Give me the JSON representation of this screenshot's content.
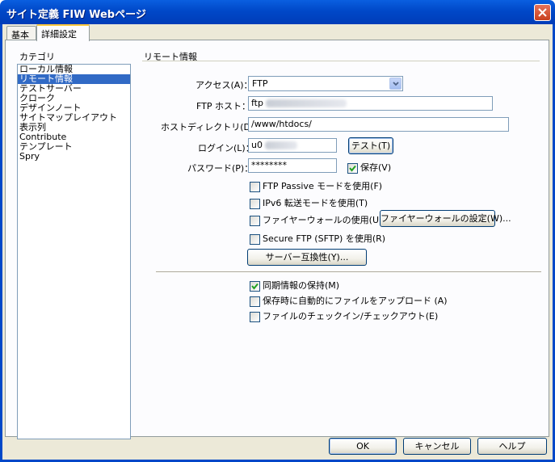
{
  "window": {
    "title": "サイト定義 FIW  Webページ"
  },
  "tabs": [
    {
      "label": "基本"
    },
    {
      "label": "詳細設定"
    }
  ],
  "category": {
    "label": "カテゴリ",
    "items": [
      "ローカル情報",
      "リモート情報",
      "テストサーバー",
      "クローク",
      "デザインノート",
      "サイトマップレイアウト",
      "表示列",
      "Contribute",
      "テンプレート",
      "Spry"
    ],
    "selected_index": 1
  },
  "remote": {
    "section_title": "リモート情報",
    "access_label": "アクセス(A)：",
    "access_value": "FTP",
    "host_label": "FTP ホスト：",
    "host_value": "ftp",
    "dir_label": "ホストディレクトリ(D)：",
    "dir_value": "/www/htdocs/",
    "login_label": "ログイン(L)：",
    "login_value": "u0",
    "test_button": "テスト(T)",
    "password_label": "パスワード(P)：",
    "password_value": "********",
    "save_label": "保存(V)",
    "save_checked": true,
    "passive_label": "FTP Passive モードを使用(F)",
    "passive_checked": false,
    "ipv6_label": "IPv6 転送モードを使用(T)",
    "ipv6_checked": false,
    "firewall_label": "ファイヤーウォールの使用(U)",
    "firewall_checked": false,
    "firewall_button": "ファイヤーウォールの設定(W)...",
    "sftp_label": "Secure FTP (SFTP) を使用(R)",
    "sftp_checked": false,
    "compat_button": "サーバー互換性(Y)...",
    "sync_label": "同期情報の保持(M)",
    "sync_checked": true,
    "autoupload_label": "保存時に自動的にファイルをアップロード (A)",
    "autoupload_checked": false,
    "checkin_label": "ファイルのチェックイン/チェックアウト(E)",
    "checkin_checked": false
  },
  "footer": {
    "ok": "OK",
    "cancel": "キャンセル",
    "help": "ヘルプ"
  }
}
